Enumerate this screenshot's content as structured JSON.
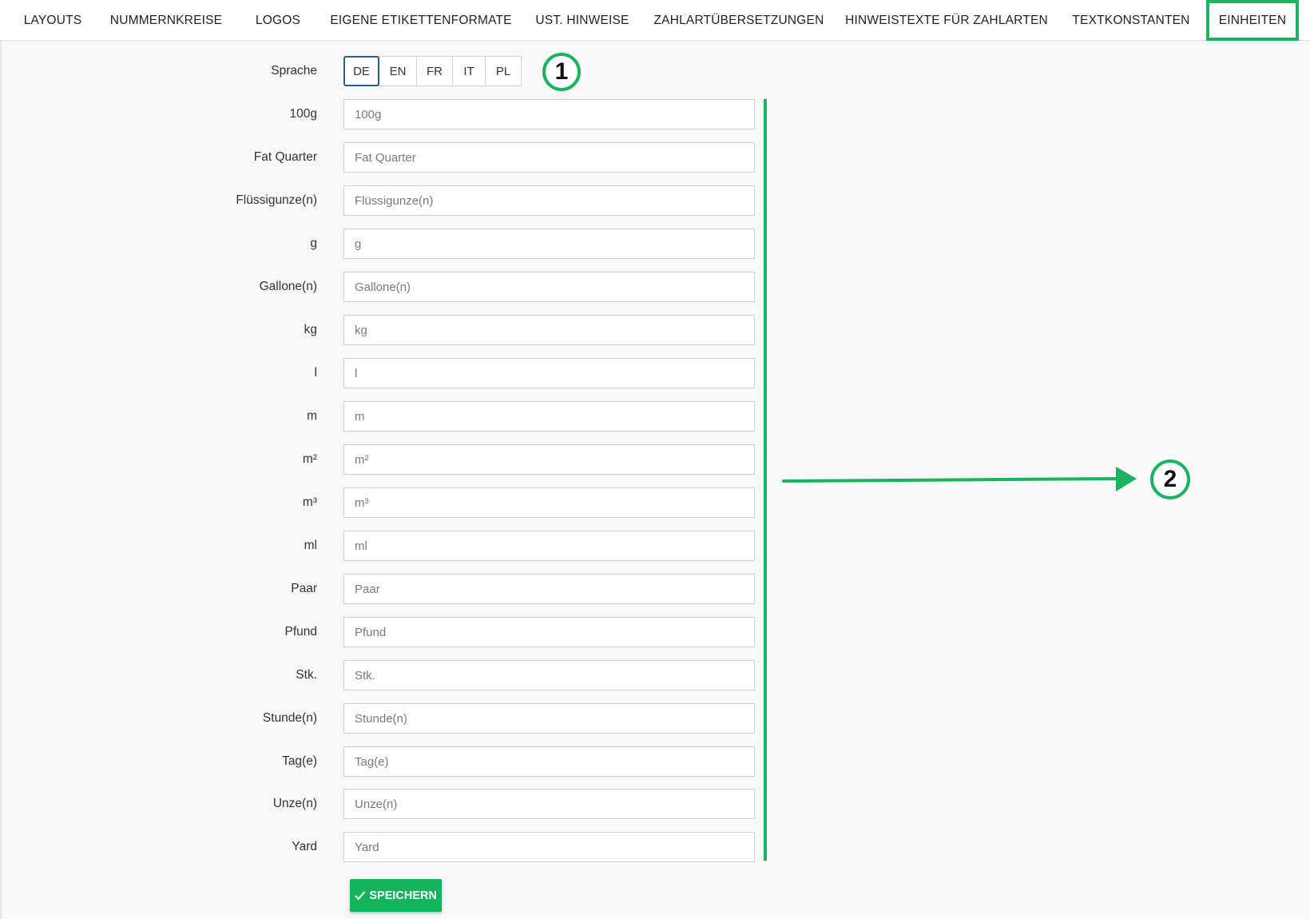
{
  "tabs": [
    {
      "label": "LAYOUTS",
      "active": false
    },
    {
      "label": "NUMMERNKREISE",
      "active": false
    },
    {
      "label": "LOGOS",
      "active": false
    },
    {
      "label": "EIGENE ETIKETTENFORMATE",
      "active": false
    },
    {
      "label": "UST. HINWEISE",
      "active": false
    },
    {
      "label": "ZAHLARTÜBERSETZUNGEN",
      "active": false
    },
    {
      "label": "HINWEISTEXTE FÜR ZAHLARTEN",
      "active": false
    },
    {
      "label": "TEXTKONSTANTEN",
      "active": false
    },
    {
      "label": "EINHEITEN",
      "active": true
    }
  ],
  "language": {
    "label": "Sprache",
    "selected": "DE",
    "options": [
      "DE",
      "EN",
      "FR",
      "IT",
      "PL"
    ]
  },
  "units": [
    {
      "label": "100g",
      "placeholder": "100g"
    },
    {
      "label": "Fat Quarter",
      "placeholder": "Fat Quarter"
    },
    {
      "label": "Flüssigunze(n)",
      "placeholder": "Flüssigunze(n)"
    },
    {
      "label": "g",
      "placeholder": "g"
    },
    {
      "label": "Gallone(n)",
      "placeholder": "Gallone(n)"
    },
    {
      "label": "kg",
      "placeholder": "kg"
    },
    {
      "label": "l",
      "placeholder": "l"
    },
    {
      "label": "m",
      "placeholder": "m"
    },
    {
      "label": "m²",
      "placeholder": "m²"
    },
    {
      "label": "m³",
      "placeholder": "m³"
    },
    {
      "label": "ml",
      "placeholder": "ml"
    },
    {
      "label": "Paar",
      "placeholder": "Paar"
    },
    {
      "label": "Pfund",
      "placeholder": "Pfund"
    },
    {
      "label": "Stk.",
      "placeholder": "Stk."
    },
    {
      "label": "Stunde(n)",
      "placeholder": "Stunde(n)"
    },
    {
      "label": "Tag(e)",
      "placeholder": "Tag(e)"
    },
    {
      "label": "Unze(n)",
      "placeholder": "Unze(n)"
    },
    {
      "label": "Yard",
      "placeholder": "Yard"
    }
  ],
  "save_button": {
    "label": "SPEICHERN",
    "icon": "check-icon"
  },
  "annotations": {
    "marker_1": "1",
    "marker_2": "2",
    "accent_color": "#1ab360"
  },
  "colors": {
    "save_button": "#14b45c",
    "selected_language_border": "#1f5f99"
  }
}
